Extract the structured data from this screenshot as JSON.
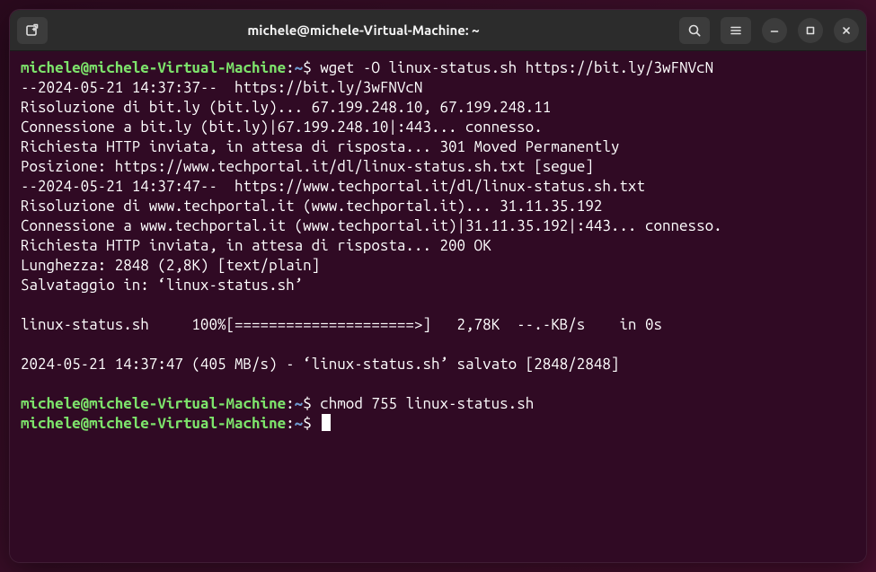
{
  "titlebar": {
    "title": "michele@michele-Virtual-Machine: ~"
  },
  "prompt": {
    "userhost": "michele@michele-Virtual-Machine",
    "sep1": ":",
    "path": "~",
    "sep2": "$"
  },
  "lines": {
    "cmd1": " wget -O linux-status.sh https://bit.ly/3wFNVcN",
    "o1": "--2024-05-21 14:37:37--  https://bit.ly/3wFNVcN",
    "o2": "Risoluzione di bit.ly (bit.ly)... 67.199.248.10, 67.199.248.11",
    "o3": "Connessione a bit.ly (bit.ly)|67.199.248.10|:443... connesso.",
    "o4": "Richiesta HTTP inviata, in attesa di risposta... 301 Moved Permanently",
    "o5": "Posizione: https://www.techportal.it/dl/linux-status.sh.txt [segue]",
    "o6": "--2024-05-21 14:37:47--  https://www.techportal.it/dl/linux-status.sh.txt",
    "o7": "Risoluzione di www.techportal.it (www.techportal.it)... 31.11.35.192",
    "o8": "Connessione a www.techportal.it (www.techportal.it)|31.11.35.192|:443... connesso.",
    "o9": "Richiesta HTTP inviata, in attesa di risposta... 200 OK",
    "o10": "Lunghezza: 2848 (2,8K) [text/plain]",
    "o11": "Salvataggio in: ‘linux-status.sh’",
    "blank1": "",
    "o12": "linux-status.sh     100%[=====================>]   2,78K  --.-KB/s    in 0s",
    "blank2": "",
    "o13": "2024-05-21 14:37:47 (405 MB/s) - ‘linux-status.sh’ salvato [2848/2848]",
    "blank3": "",
    "cmd2": " chmod 755 linux-status.sh",
    "cmd3": " "
  }
}
